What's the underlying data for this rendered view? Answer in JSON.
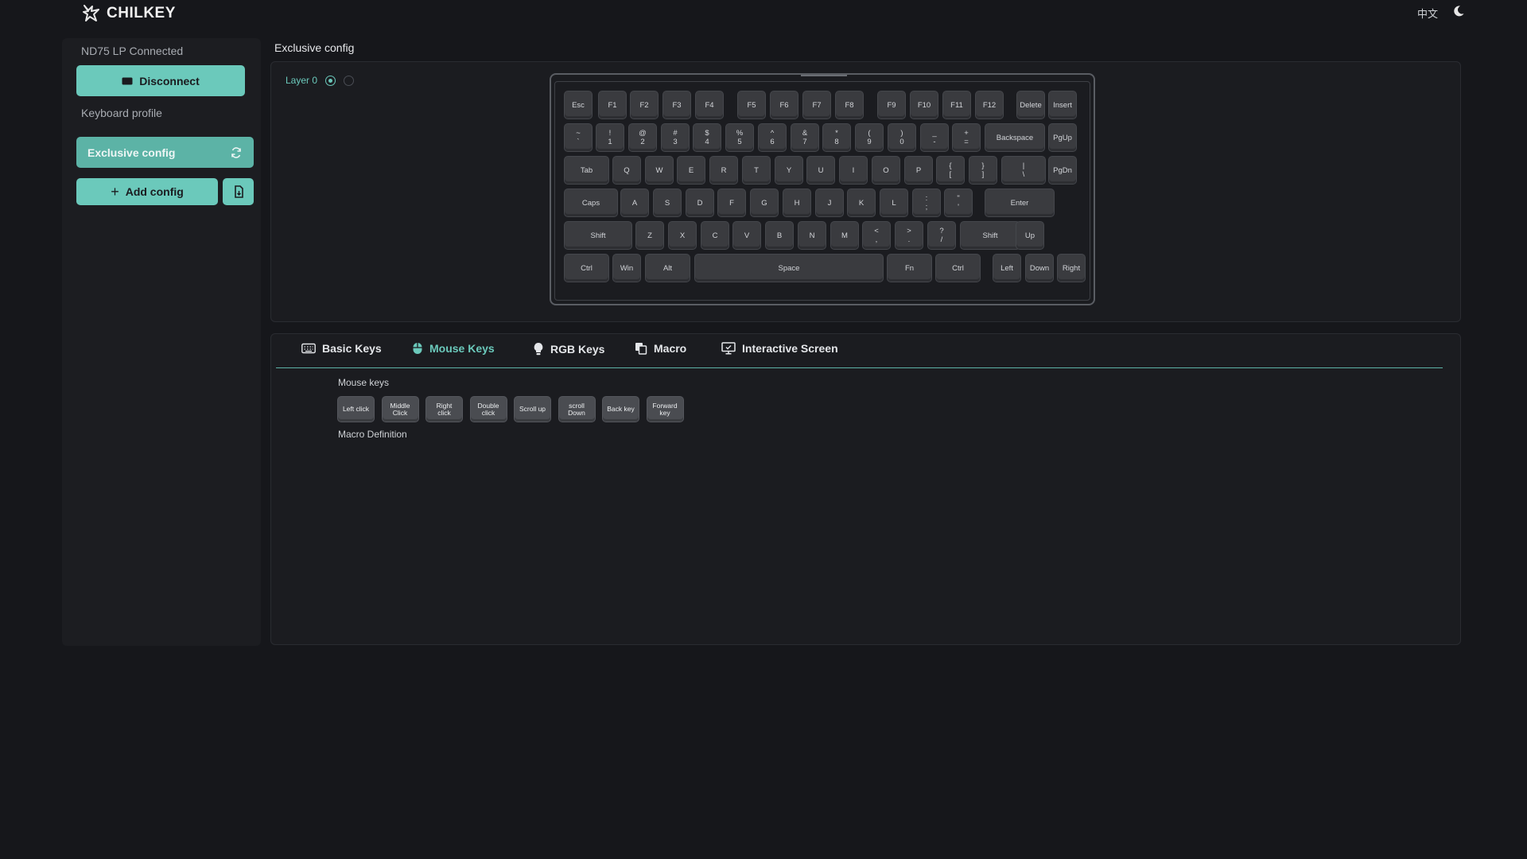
{
  "app": {
    "brand": "CHILKEY",
    "language_toggle": "中文"
  },
  "sidebar": {
    "connection_status": "ND75 LP Connected",
    "disconnect_label": "Disconnect",
    "profile_heading": "Keyboard profile",
    "configs": [
      {
        "label": "Exclusive config"
      }
    ],
    "add_config_label": "Add config"
  },
  "main": {
    "title": "Exclusive config",
    "layer": {
      "label": "Layer 0",
      "options": 2,
      "selected": 0
    }
  },
  "keyboard": {
    "rows": [
      [
        [
          "Esc"
        ],
        [
          "F1"
        ],
        [
          "F2"
        ],
        [
          "F3"
        ],
        [
          "F4"
        ],
        [
          "F5"
        ],
        [
          "F6"
        ],
        [
          "F7"
        ],
        [
          "F8"
        ],
        [
          "F9"
        ],
        [
          "F10"
        ],
        [
          "F11"
        ],
        [
          "F12"
        ],
        [
          "Delete"
        ],
        [
          "Insert"
        ]
      ],
      [
        [
          "~",
          "`"
        ],
        [
          "!",
          "1"
        ],
        [
          "@",
          "2"
        ],
        [
          "#",
          "3"
        ],
        [
          "$",
          "4"
        ],
        [
          "%",
          "5"
        ],
        [
          "^",
          "6"
        ],
        [
          "&",
          "7"
        ],
        [
          "*",
          "8"
        ],
        [
          "(",
          "9"
        ],
        [
          ")",
          "0"
        ],
        [
          "_",
          "-"
        ],
        [
          "+",
          "="
        ],
        [
          "Backspace"
        ],
        [
          "PgUp"
        ]
      ],
      [
        [
          "Tab"
        ],
        [
          "Q"
        ],
        [
          "W"
        ],
        [
          "E"
        ],
        [
          "R"
        ],
        [
          "T"
        ],
        [
          "Y"
        ],
        [
          "U"
        ],
        [
          "I"
        ],
        [
          "O"
        ],
        [
          "P"
        ],
        [
          "{",
          "["
        ],
        [
          "}",
          "]"
        ],
        [
          "|",
          "\\"
        ],
        [
          "PgDn"
        ]
      ],
      [
        [
          "Caps"
        ],
        [
          "A"
        ],
        [
          "S"
        ],
        [
          "D"
        ],
        [
          "F"
        ],
        [
          "G"
        ],
        [
          "H"
        ],
        [
          "J"
        ],
        [
          "K"
        ],
        [
          "L"
        ],
        [
          ":",
          ";"
        ],
        [
          "\"",
          "'"
        ],
        [
          "Enter"
        ]
      ],
      [
        [
          "Shift"
        ],
        [
          "Z"
        ],
        [
          "X"
        ],
        [
          "C"
        ],
        [
          "V"
        ],
        [
          "B"
        ],
        [
          "N"
        ],
        [
          "M"
        ],
        [
          "<",
          ","
        ],
        [
          ">",
          "."
        ],
        [
          "?",
          "/"
        ],
        [
          "Shift"
        ],
        [
          "Up"
        ]
      ],
      [
        [
          "Ctrl"
        ],
        [
          "Win"
        ],
        [
          "Alt"
        ],
        [
          "Space"
        ],
        [
          "Fn"
        ],
        [
          "Ctrl"
        ],
        [
          "Left"
        ],
        [
          "Down"
        ],
        [
          "Right"
        ]
      ]
    ]
  },
  "tabs": [
    {
      "label": "Basic Keys",
      "icon": "keyboard-icon"
    },
    {
      "label": "Mouse Keys",
      "icon": "mouse-icon",
      "active": true
    },
    {
      "label": "RGB Keys",
      "icon": "bulb-icon"
    },
    {
      "label": "Macro",
      "icon": "copy-icon"
    },
    {
      "label": "Interactive Screen",
      "icon": "monitor-icon"
    }
  ],
  "mouse_section": {
    "title": "Mouse keys",
    "keys": [
      [
        "Left click"
      ],
      [
        "Middle",
        "Click"
      ],
      [
        "Right",
        "click"
      ],
      [
        "Double",
        "click"
      ],
      [
        "Scroll up"
      ],
      [
        "scroll",
        "Down"
      ],
      [
        "Back key"
      ],
      [
        "Forward",
        "key"
      ]
    ]
  },
  "macro_section": {
    "title": "Macro Definition"
  },
  "colors": {
    "accent": "#6bc9bb",
    "background": "#16171b",
    "panel": "#1b1c20",
    "key": "#3a3b3f"
  }
}
